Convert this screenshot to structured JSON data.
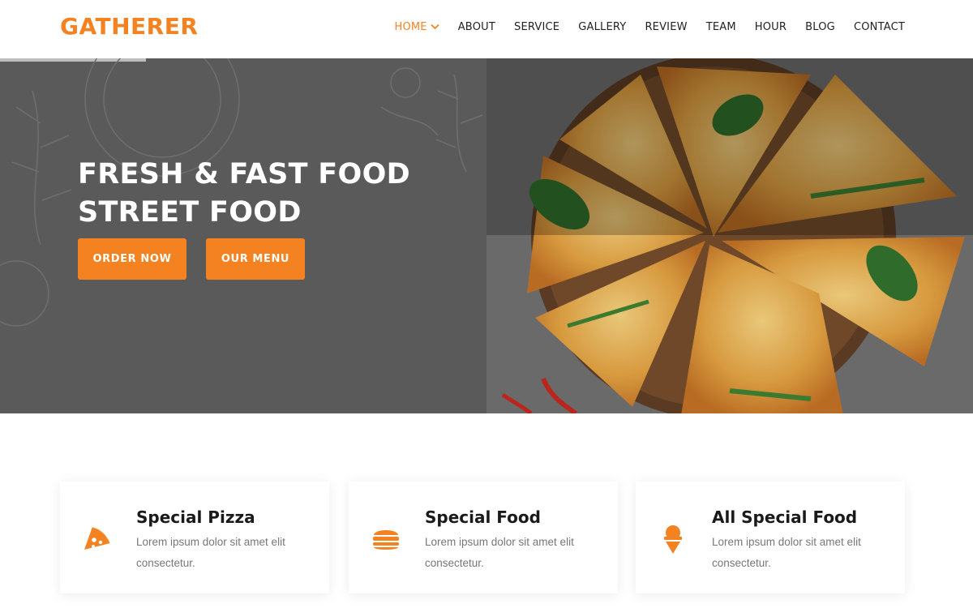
{
  "brand": {
    "logo_text": "GATHERER",
    "accent_color": "#f58220"
  },
  "nav": {
    "items": [
      {
        "label": "HOME",
        "active": true,
        "icon": "chevron-down-icon"
      },
      {
        "label": "ABOUT",
        "active": false
      },
      {
        "label": "SERVICE",
        "active": false
      },
      {
        "label": "GALLERY",
        "active": false
      },
      {
        "label": "REVIEW",
        "active": false
      },
      {
        "label": "TEAM",
        "active": false
      },
      {
        "label": "HOUR",
        "active": false
      },
      {
        "label": "BLOG",
        "active": false
      },
      {
        "label": "CONTACT",
        "active": false
      }
    ]
  },
  "hero": {
    "title_line1": "FRESH & FAST FOOD",
    "title_line2": "STREET FOOD",
    "order_button": "ORDER NOW",
    "menu_button": "OUR MENU",
    "image": "pizza-on-wooden-board"
  },
  "features": [
    {
      "icon": "pizza-slice-icon",
      "title": "Special Pizza",
      "text": "Lorem ipsum dolor sit amet elit consectetur."
    },
    {
      "icon": "burger-icon",
      "title": "Special Food",
      "text": "Lorem ipsum dolor sit amet elit consectetur."
    },
    {
      "icon": "ice-cream-icon",
      "title": "All Special Food",
      "text": "Lorem ipsum dolor sit amet elit consectetur."
    }
  ]
}
